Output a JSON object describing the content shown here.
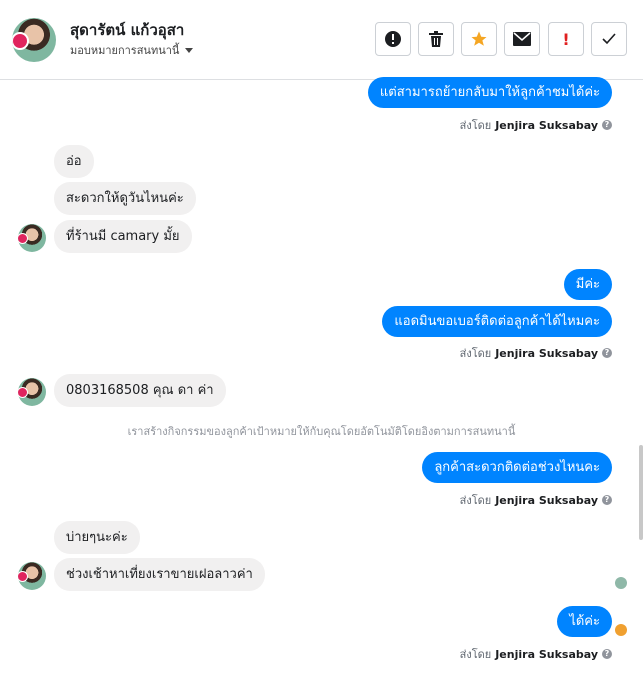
{
  "header": {
    "contact_name": "สุดารัตน์ แก้วอุสา",
    "assign_label": "มอบหมายการสนทนานี้",
    "toolbar": {
      "info": "info-icon",
      "trash": "trash-icon",
      "star": "star-icon",
      "mail": "envelope-icon",
      "important": "!",
      "done": "check-icon"
    },
    "colors": {
      "star": "#f5a623",
      "important": "#e02020"
    }
  },
  "messages": {
    "m1": "แต่สามารถย้ายกลับมาให้ลูกค้าชมได้ค่ะ",
    "sent_prefix": "ส่งโดย",
    "sender": "Jenjira Suksabay",
    "m2": "อ่อ",
    "m3": "สะดวกให้ดูวันไหนค่ะ",
    "m4": "ที่ร้านมี camary มั้ย",
    "m5": "มีค่ะ",
    "m6": "แอดมินขอเบอร์ติดต่อลูกค้าได้ไหมคะ",
    "m7": "0803168508 คุณ ดา ค่า",
    "system": "เราสร้างกิจกรรมของลูกค้าเป้าหมายให้กับคุณโดยอัตโนมัติโดยอิงตามการสนทนานี้",
    "m8": "ลูกค้าสะดวกติดต่อช่วงไหนคะ",
    "m9": "บ่ายๆนะค่ะ",
    "m10": "ช่วงเช้าหาเที่ยงเราขายเฝอลาวค่า",
    "m11": "ได้ค่ะ"
  },
  "colors": {
    "outgoing": "#0084ff",
    "incoming": "#f1f0f0"
  }
}
